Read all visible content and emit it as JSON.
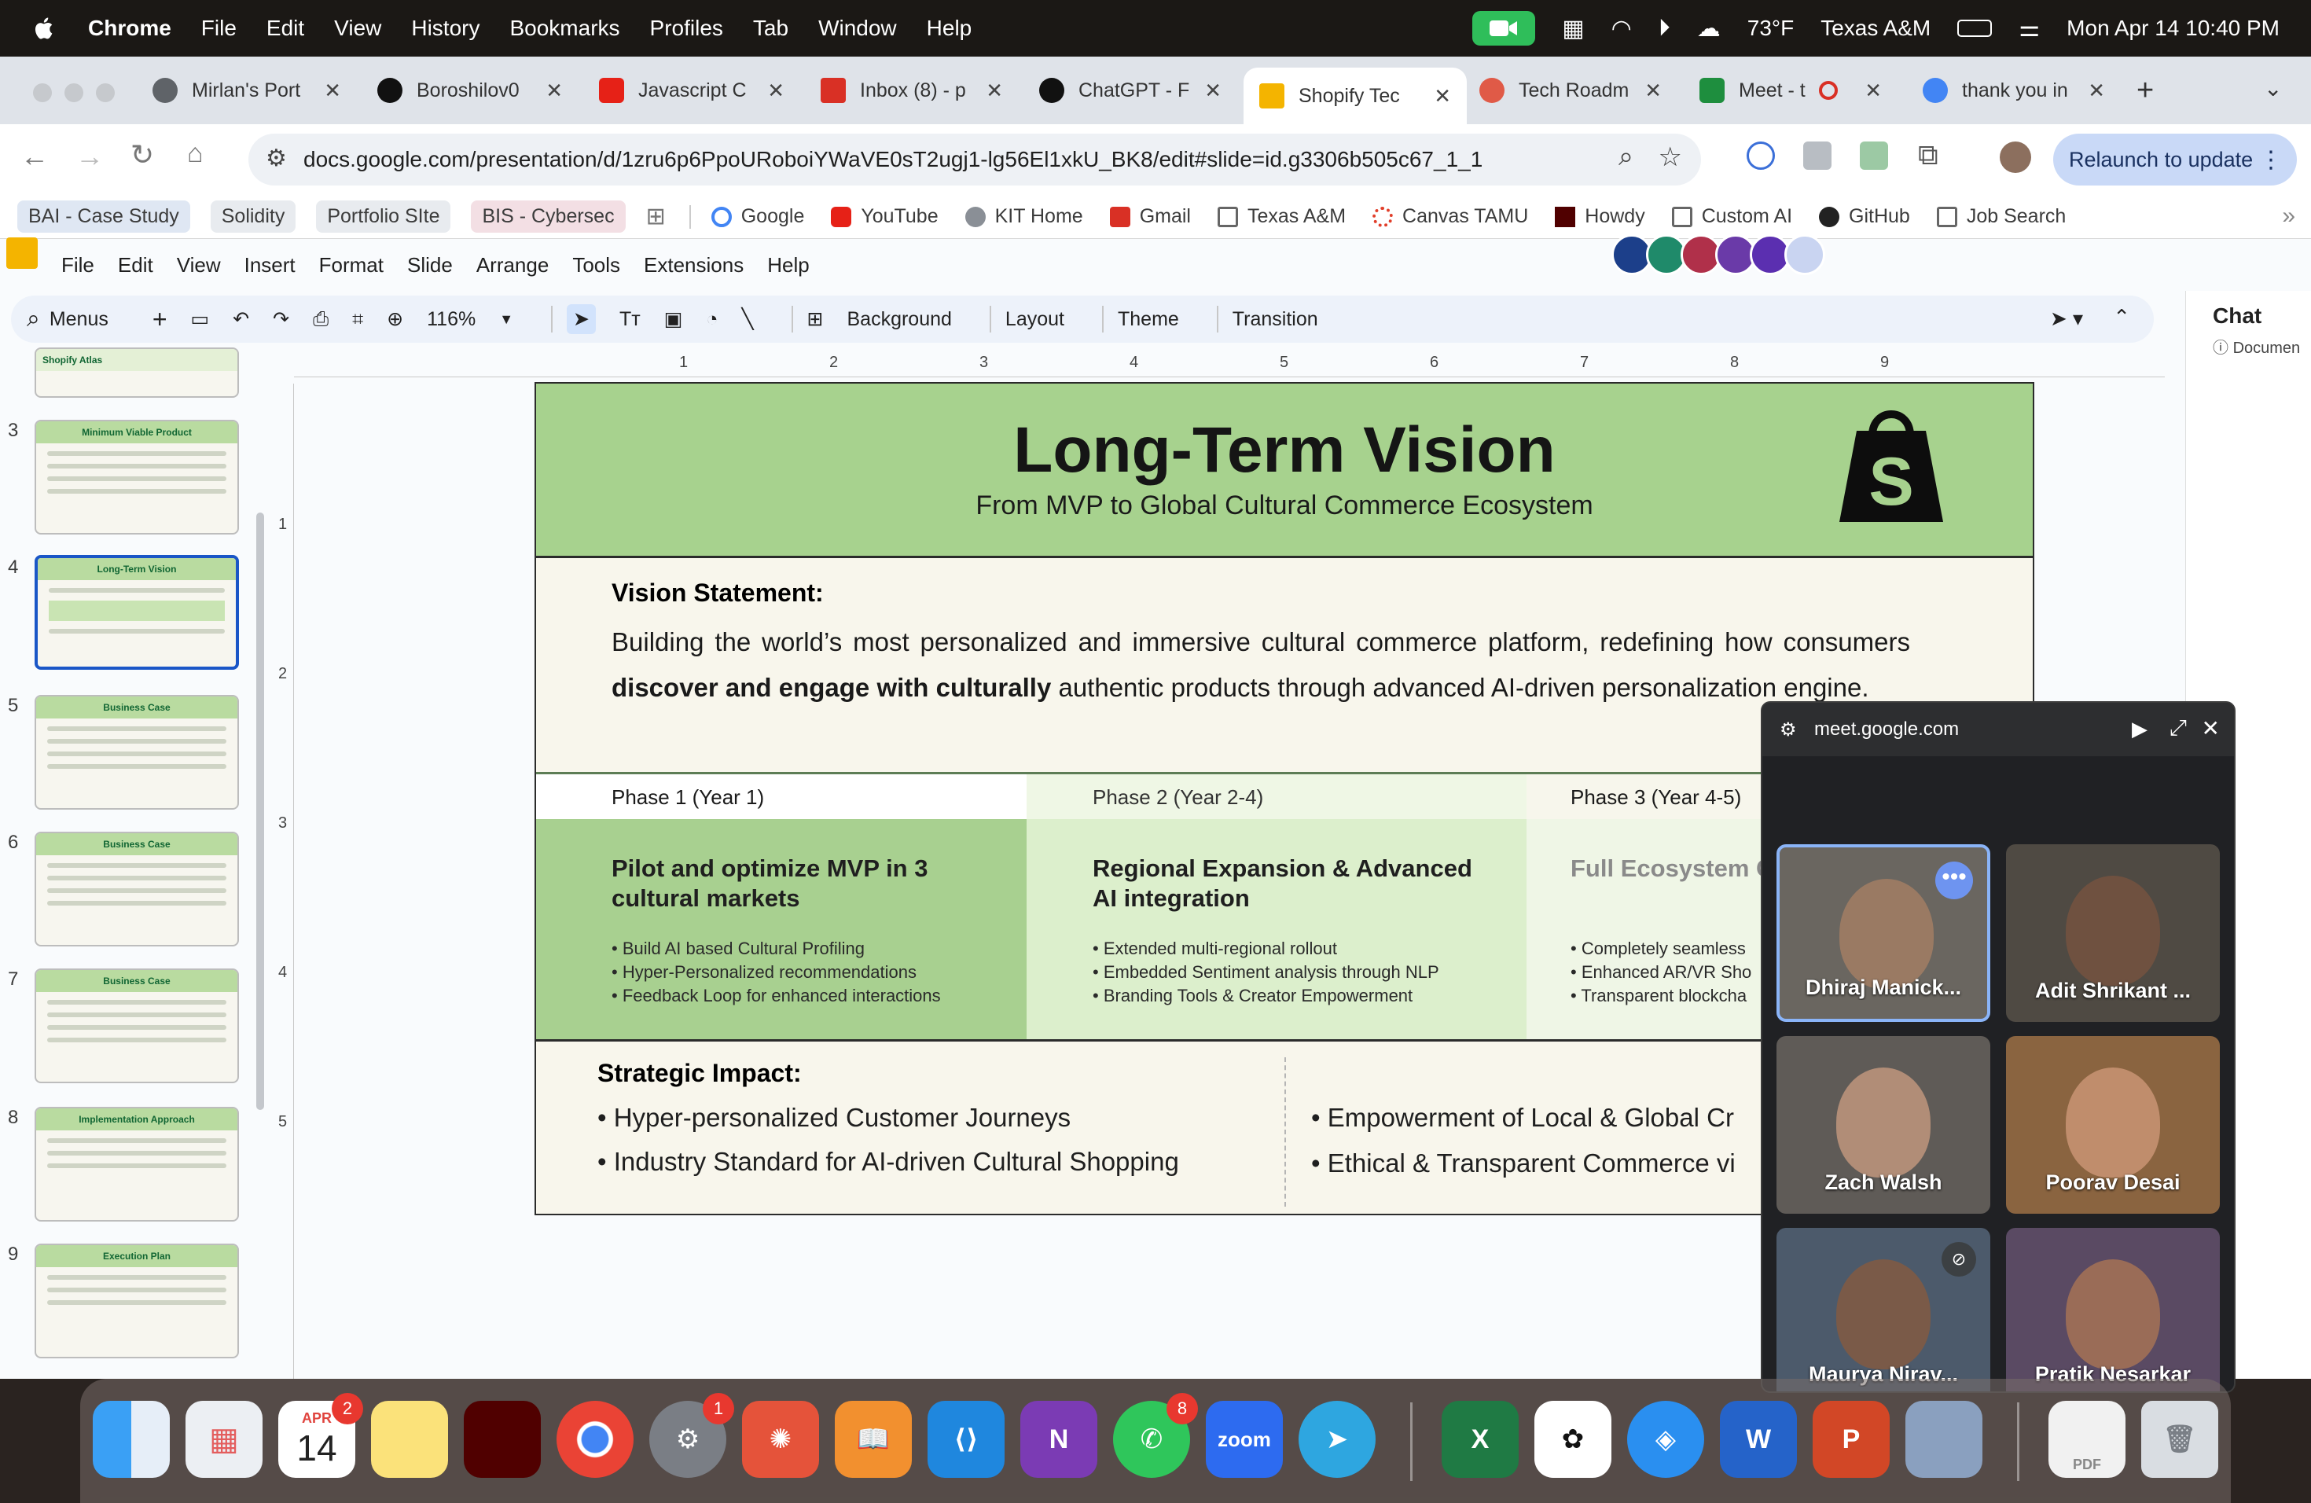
{
  "menubar": {
    "app": "Chrome",
    "items": [
      "File",
      "Edit",
      "View",
      "History",
      "Bookmarks",
      "Profiles",
      "Tab",
      "Window",
      "Help"
    ],
    "weather": "73°F",
    "location": "Texas A&M",
    "datetime": "Mon Apr 14  10:40 PM"
  },
  "tabs": [
    {
      "title": "Mirlan's Port",
      "color": "#5f6368"
    },
    {
      "title": "Boroshilov0",
      "color": "#111111"
    },
    {
      "title": "Javascript C",
      "color": "#e62117"
    },
    {
      "title": "Inbox (8) - p",
      "color": "#d93025"
    },
    {
      "title": "ChatGPT - F",
      "color": "#111111"
    },
    {
      "title": "Shopify Tec",
      "color": "#f4b400"
    },
    {
      "title": "Tech Roadm",
      "color": "#e05a47"
    },
    {
      "title": "Meet - t",
      "color": "#1e8e3e"
    },
    {
      "title": "thank you in",
      "color": "#4285f4"
    }
  ],
  "address": {
    "url": "docs.google.com/presentation/d/1zru6p6PpoURoboiYWaVE0sT2ugj1-lg56El1xkU_BK8/edit#slide=id.g3306b505c67_1_1",
    "relaunch": "Relaunch to update"
  },
  "bookmarks": {
    "chips": [
      "BAI - Case Study",
      "Solidity",
      "Portfolio SIte",
      "BIS - Cybersec"
    ],
    "links": [
      "Google",
      "YouTube",
      "KIT Home",
      "Gmail",
      "Texas A&M",
      "Canvas TAMU",
      "Howdy",
      "Custom AI",
      "GitHub",
      "Job Search"
    ]
  },
  "slides_menu": [
    "File",
    "Edit",
    "View",
    "Insert",
    "Format",
    "Slide",
    "Arrange",
    "Tools",
    "Extensions",
    "Help"
  ],
  "toolbar": {
    "menus": "Menus",
    "zoom": "116%",
    "background": "Background",
    "layout": "Layout",
    "theme": "Theme",
    "transition": "Transition"
  },
  "filmstrip": [
    {
      "num": "",
      "title": "Shopify Atlas"
    },
    {
      "num": "3",
      "title": "Minimum Viable Product"
    },
    {
      "num": "4",
      "title": "Long-Term Vision"
    },
    {
      "num": "5",
      "title": "Business Case"
    },
    {
      "num": "6",
      "title": "Business Case"
    },
    {
      "num": "7",
      "title": "Business Case"
    },
    {
      "num": "8",
      "title": "Implementation Approach"
    },
    {
      "num": "9",
      "title": "Execution Plan"
    }
  ],
  "ruler_h": [
    "1",
    "2",
    "3",
    "4",
    "5",
    "6",
    "7",
    "8",
    "9"
  ],
  "ruler_v": [
    "1",
    "2",
    "3",
    "4",
    "5"
  ],
  "slide": {
    "title": "Long-Term Vision",
    "subtitle": "From MVP to Global Cultural Commerce Ecosystem",
    "vision_heading": "Vision Statement:",
    "vision_1": "Building the world’s most personalized and immersive cultural commerce platform, redefining how consumers ",
    "vision_bold": "discover and engage with culturally",
    "vision_2": " authentic products through advanced AI-driven personalization engine.",
    "phases": [
      {
        "label": "Phase 1 (Year 1)",
        "heading": "Pilot and optimize MVP in 3 cultural markets",
        "items": [
          "• Build AI based Cultural Profiling",
          "• Hyper-Personalized recommendations",
          "• Feedback Loop for enhanced interactions"
        ]
      },
      {
        "label": "Phase 2 (Year 2-4)",
        "heading": "Regional Expansion & Advanced AI integration",
        "items": [
          "• Extended multi-regional rollout",
          "• Embedded Sentiment analysis through NLP",
          "• Branding Tools & Creator Empowerment"
        ]
      },
      {
        "label": "Phase 3 (Year 4-5)",
        "heading": "Full Ecosystem Commerce",
        "items": [
          "• Completely seamless",
          "• Enhanced AR/VR Sho",
          "• Transparent blockcha"
        ]
      }
    ],
    "impact_heading": "Strategic Impact:",
    "impact_left": [
      "• Hyper-personalized Customer Journeys",
      "• Industry Standard for AI-driven Cultural Shopping"
    ],
    "impact_right": [
      "• Empowerment of Local & Global Cr",
      "• Ethical & Transparent Commerce vi"
    ]
  },
  "chat": {
    "title": "Chat",
    "sub": "Documen"
  },
  "meet": {
    "domain": "meet.google.com",
    "participants": [
      "Dhiraj Manick...",
      "Adit Shrikant ...",
      "Zach Walsh",
      "Poorav Desai",
      "Maurya Nirav...",
      "Pratik Nesarkar"
    ]
  },
  "dock": {
    "calendar_month": "APR",
    "calendar_day": "14",
    "calendar_badge": "2",
    "settings_badge": "1",
    "whatsapp_badge": "8",
    "zoom": "zoom",
    "excel": "X",
    "onenote": "N",
    "word": "W",
    "powerpoint": "P",
    "pdf": "PDF"
  }
}
